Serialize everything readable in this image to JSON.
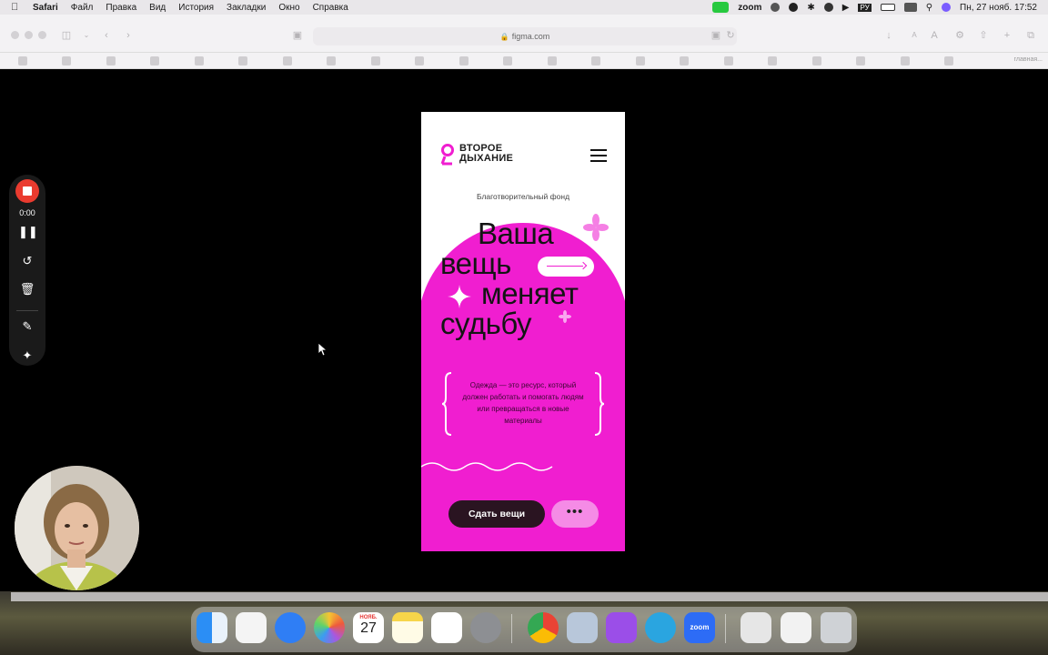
{
  "menubar": {
    "app": "Safari",
    "items": [
      "Файл",
      "Правка",
      "Вид",
      "История",
      "Закладки",
      "Окно",
      "Справка"
    ],
    "zoom_label": "zoom",
    "keyboard_layout": "РУ",
    "datetime": "Пн, 27 нояб. 17:52"
  },
  "browser": {
    "url": "figma.com",
    "bookmark_last": "главная..."
  },
  "recorder": {
    "time": "0:00"
  },
  "mobile": {
    "logo_line1": "ВТОРОЕ",
    "logo_line2": "ДЫХАНИЕ",
    "subtitle": "Благотворительный фонд",
    "headline": {
      "line1": "Ваша",
      "line2": "вещь",
      "line3": "меняет",
      "line4": "судьбу"
    },
    "description": "Одежда — это ресурс, который должен работать и помогать людям или превращаться в новые материалы",
    "cta_label": "Сдать вещи",
    "more_label": "•••"
  },
  "dock": {
    "calendar_month": "НОЯБ.",
    "calendar_day": "27",
    "zoom_label": "zoom"
  },
  "colors": {
    "brand_pink": "#f01ed0",
    "dark": "#2a1421",
    "light_pink": "#f58be6"
  }
}
